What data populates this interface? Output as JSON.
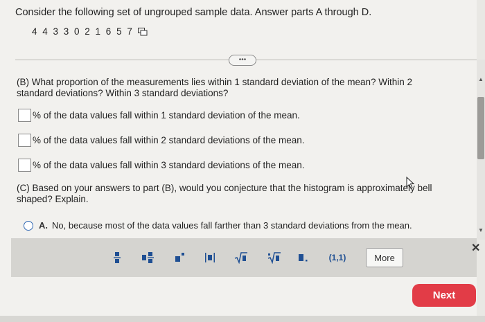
{
  "intro": {
    "text": "Consider the following set of ungrouped sample data. Answer parts A through D."
  },
  "sample": {
    "values": "4 4 3 3 0 2 1 6 5 7"
  },
  "expand": {
    "label": "•••"
  },
  "partB": {
    "question": "(B) What proportion of the measurements lies within 1 standard deviation of the mean? Within 2 standard deviations? Within 3 standard deviations?",
    "rows": [
      "% of the data values fall within 1 standard deviation of the mean.",
      "% of the data values fall within 2 standard deviations of the mean.",
      "% of the data values fall within 3 standard deviations of the mean."
    ]
  },
  "partC": {
    "question": "(C) Based on your answers to part (B), would you conjecture that the histogram is approximately bell shaped? Explain.",
    "option": {
      "letter": "A.",
      "text": "No, because most of the data values fall farther than 3 standard deviations from the mean."
    }
  },
  "toolbar": {
    "tools": [
      "fraction-icon",
      "mixed-number-icon",
      "exponent-icon",
      "absolute-value-icon",
      "square-root-icon",
      "nth-root-icon",
      "decimal-icon",
      "interval-icon"
    ],
    "interval_label": "(1,1)",
    "more_label": "More"
  },
  "next": {
    "label": "Next"
  },
  "colors": {
    "accent": "#1f4f93",
    "next": "#e23c47"
  }
}
